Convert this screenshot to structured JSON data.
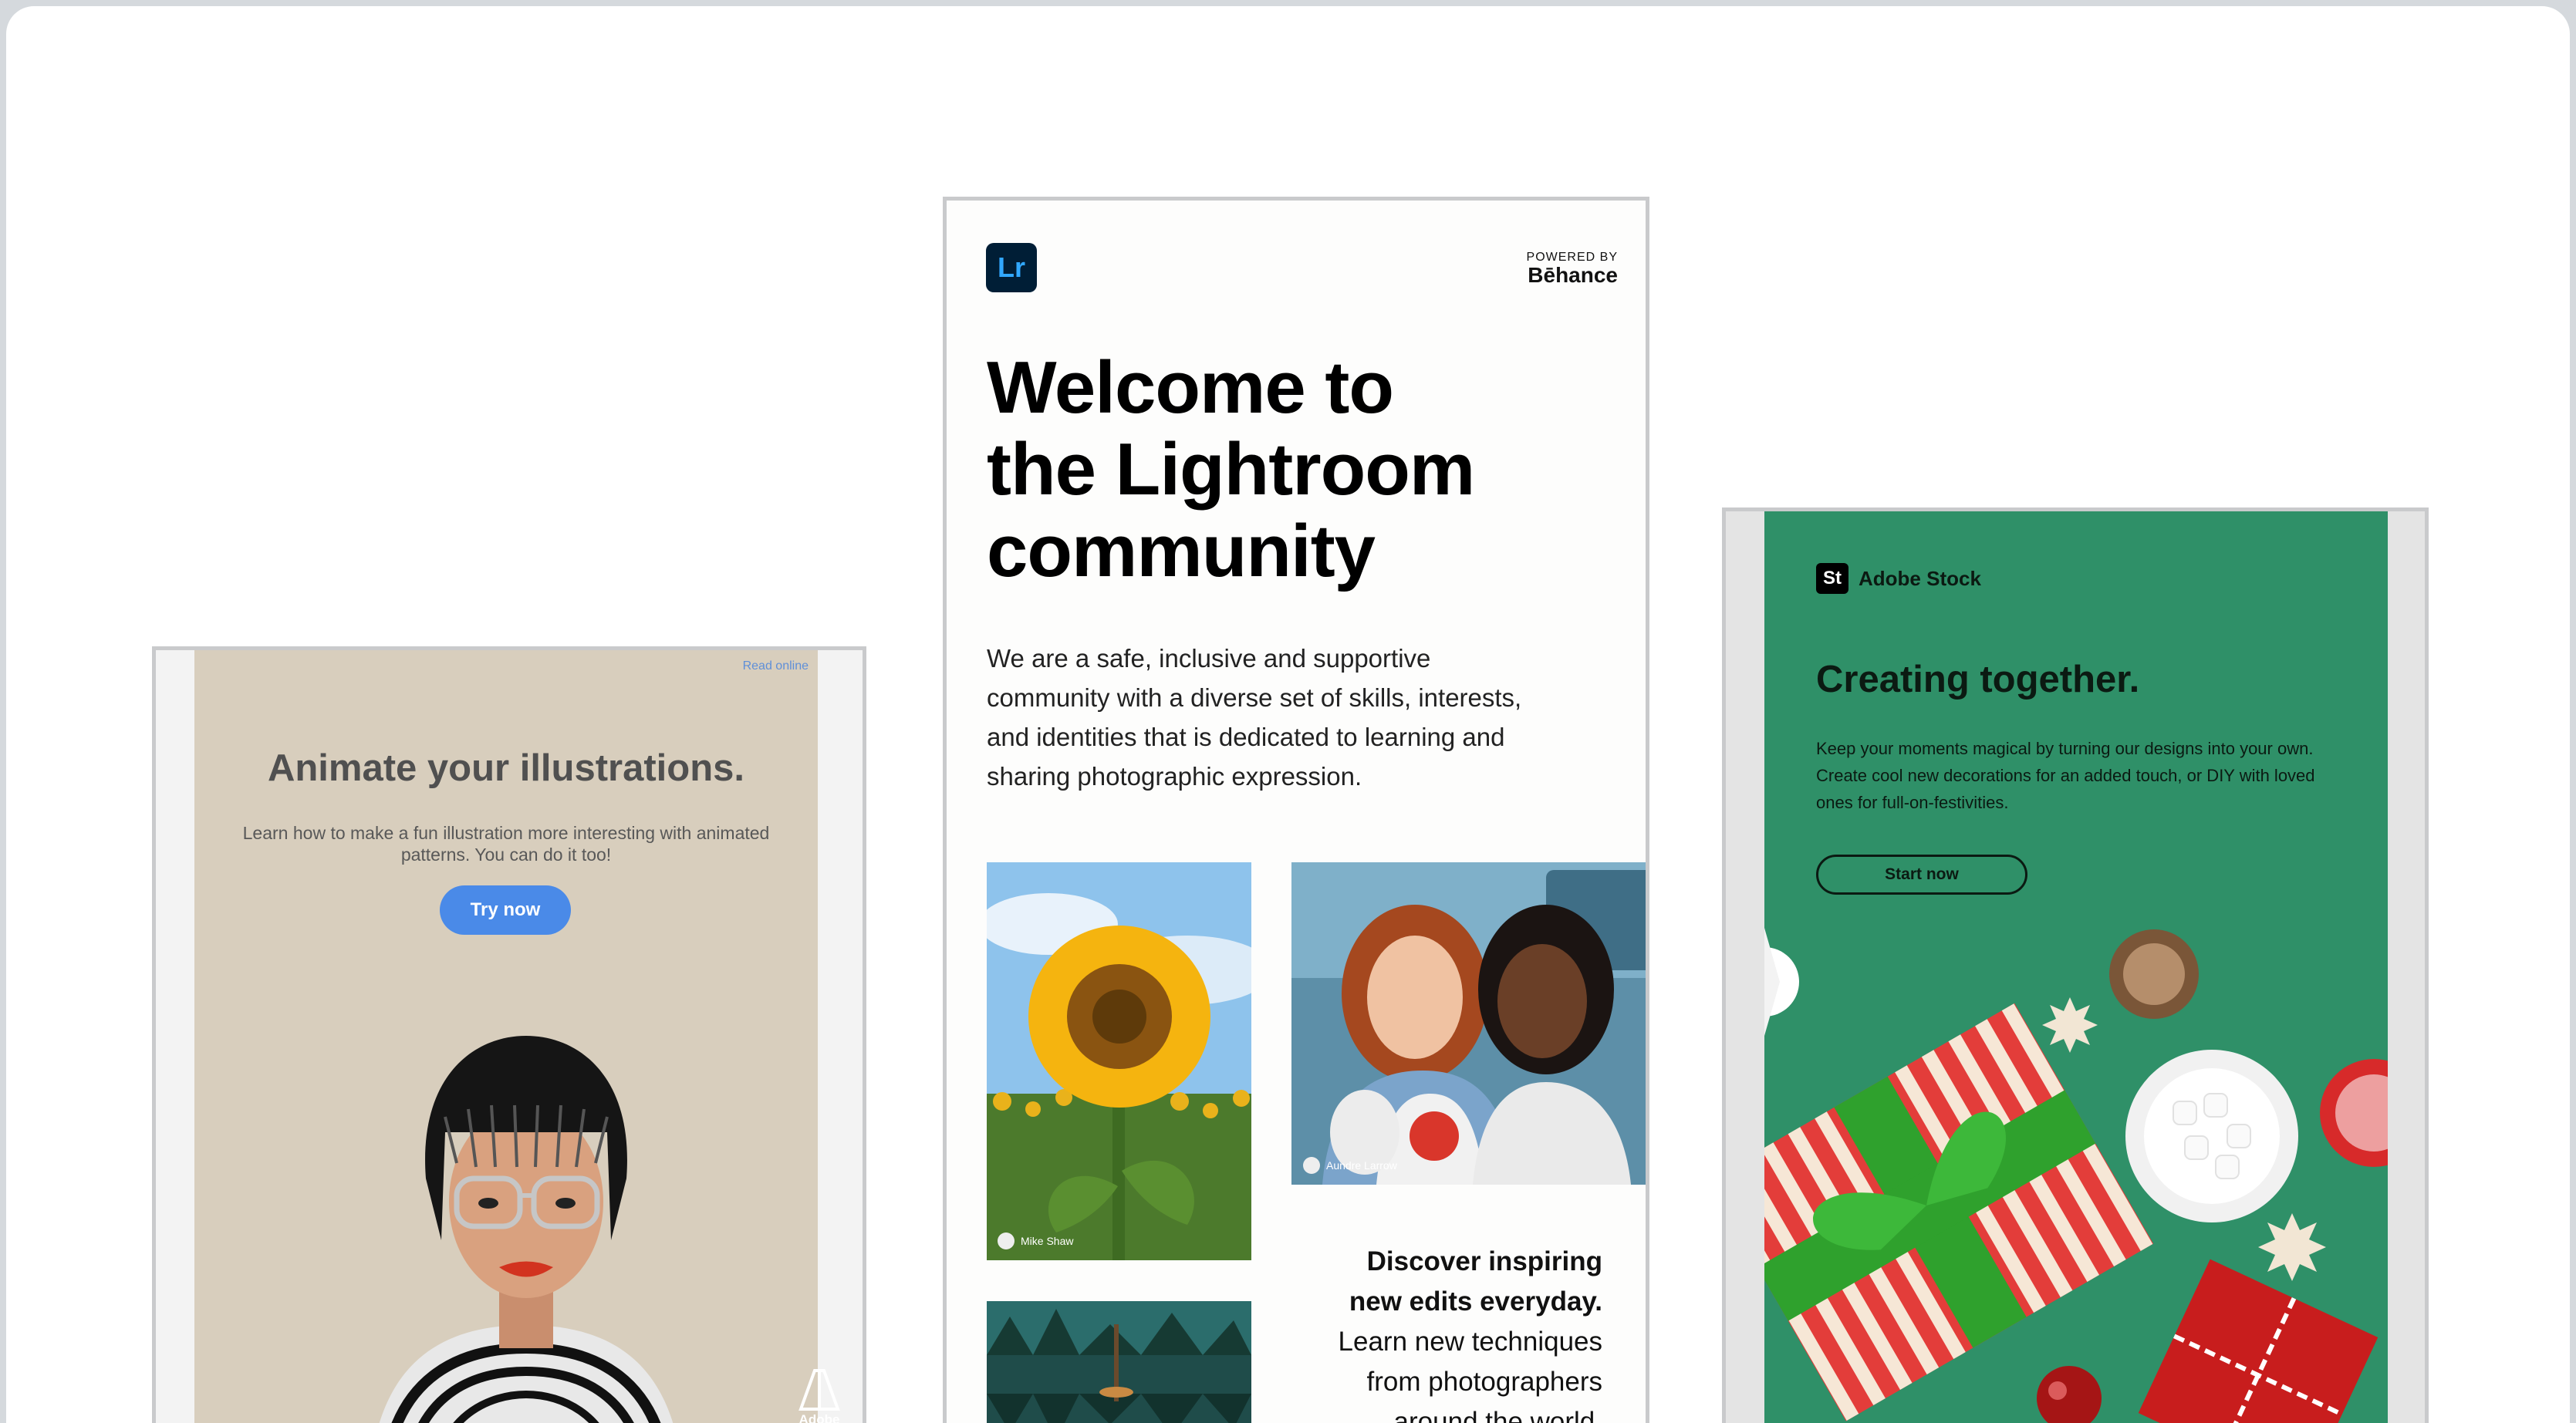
{
  "cards": {
    "animate": {
      "read_online": "Read online",
      "title": "Animate your illustrations.",
      "text": "Learn how to make a fun illustration more interesting with animated patterns. You can do it too!",
      "button": "Try now",
      "brand": "Adobe"
    },
    "lightroom": {
      "logo": "Lr",
      "powered_by": "POWERED BY",
      "behance": "Bēhance",
      "title_line1": "Welcome to",
      "title_line2": "the Lightroom",
      "title_line3": "community",
      "text": "We are a safe, inclusive and supportive community with a diverse set of skills, interests, and identities that is dedicated to learning and sharing photographic expression.",
      "credit_sunflower": "Mike Shaw",
      "credit_friends": "Aundre Larrow",
      "discover_bold_1": "Discover inspiring",
      "discover_bold_2": "new edits everyday.",
      "discover_1": "Learn new techniques",
      "discover_2": "from photographers",
      "discover_3": "around the world."
    },
    "stock": {
      "logo": "St",
      "brand": "Adobe Stock",
      "title": "Creating together.",
      "text": "Keep your moments magical by turning our designs into your own. Create cool new decorations for an added touch, or DIY with loved ones for full-on-festivities.",
      "button": "Start now"
    }
  },
  "colors": {
    "animate_bg": "#d8cebd",
    "try_button": "#4a8ae8",
    "lightroom_logo_bg": "#001e36",
    "lightroom_logo_fg": "#31a8ff",
    "stock_bg": "#2f9068"
  }
}
